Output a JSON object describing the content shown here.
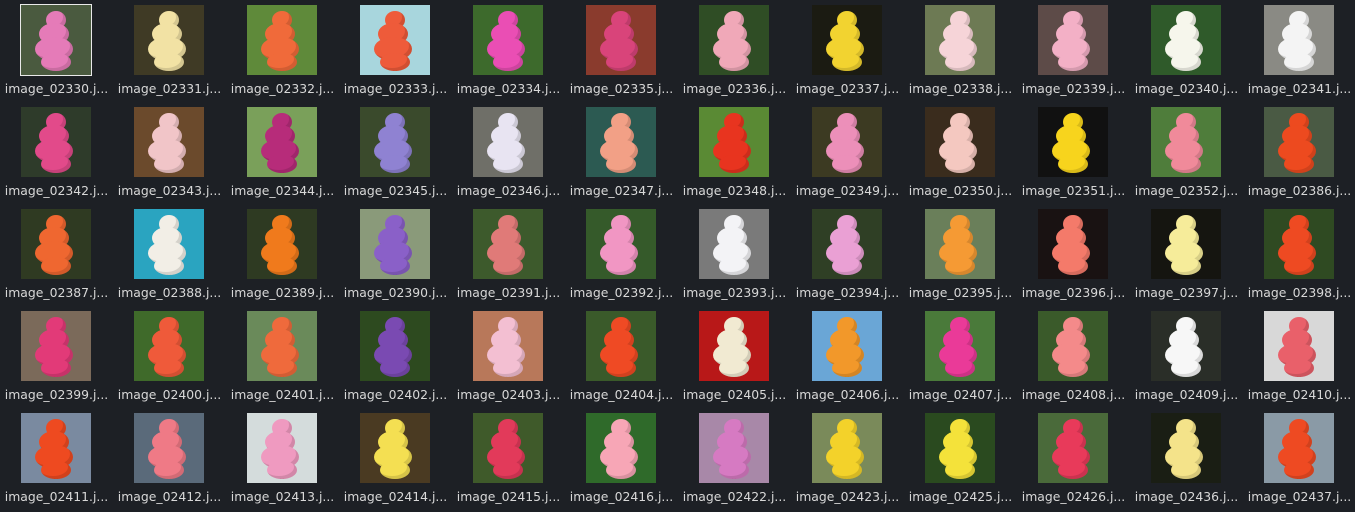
{
  "files": [
    {
      "name": "image_02330.j...",
      "color": "#e57bb8",
      "bg": "#4a5a3f",
      "selected": true
    },
    {
      "name": "image_02331.j...",
      "color": "#f2e2a4",
      "bg": "#3f3a25"
    },
    {
      "name": "image_02332.j...",
      "color": "#f06a3a",
      "bg": "#5f8a3a"
    },
    {
      "name": "image_02333.j...",
      "color": "#ee5b3a",
      "bg": "#a8d6dd"
    },
    {
      "name": "image_02334.j...",
      "color": "#ea4eb4",
      "bg": "#3d6a2c"
    },
    {
      "name": "image_02335.j...",
      "color": "#d9447a",
      "bg": "#8a3b2d"
    },
    {
      "name": "image_02336.j...",
      "color": "#f0a8b8",
      "bg": "#2f4d25"
    },
    {
      "name": "image_02337.j...",
      "color": "#f2d330",
      "bg": "#1b1b12"
    },
    {
      "name": "image_02338.j...",
      "color": "#f6d4d8",
      "bg": "#6d7a54"
    },
    {
      "name": "image_02339.j...",
      "color": "#f3b0c6",
      "bg": "#5d4b48"
    },
    {
      "name": "image_02340.j...",
      "color": "#f6f6ec",
      "bg": "#2f5a2a"
    },
    {
      "name": "image_02341.j...",
      "color": "#f4f4f4",
      "bg": "#8a8a84"
    },
    {
      "name": "image_02342.j...",
      "color": "#e24a8a",
      "bg": "#2e3b2a"
    },
    {
      "name": "image_02343.j...",
      "color": "#f1c5c8",
      "bg": "#6b4a2c"
    },
    {
      "name": "image_02344.j...",
      "color": "#b72c7a",
      "bg": "#7aa05a"
    },
    {
      "name": "image_02345.j...",
      "color": "#8f82d2",
      "bg": "#3a4a2c"
    },
    {
      "name": "image_02346.j...",
      "color": "#e8e4f2",
      "bg": "#6f6f68"
    },
    {
      "name": "image_02347.j...",
      "color": "#f2a086",
      "bg": "#2c5a52"
    },
    {
      "name": "image_02348.j...",
      "color": "#e8341f",
      "bg": "#5a8a34"
    },
    {
      "name": "image_02349.j...",
      "color": "#ec8fb9",
      "bg": "#3c3a22"
    },
    {
      "name": "image_02350.j...",
      "color": "#f4c8c0",
      "bg": "#3a2c1d"
    },
    {
      "name": "image_02351.j...",
      "color": "#f7d41d",
      "bg": "#111111"
    },
    {
      "name": "image_02352.j...",
      "color": "#f08a9a",
      "bg": "#4f7d3b"
    },
    {
      "name": "image_02386.j...",
      "color": "#ed4a1f",
      "bg": "#4a5a44"
    },
    {
      "name": "image_02387.j...",
      "color": "#ef6730",
      "bg": "#2f3a22"
    },
    {
      "name": "image_02388.j...",
      "color": "#f2eee6",
      "bg": "#2aa4c0"
    },
    {
      "name": "image_02389.j...",
      "color": "#f07a1c",
      "bg": "#2e3a22"
    },
    {
      "name": "image_02390.j...",
      "color": "#8a60c8",
      "bg": "#8a9a7a"
    },
    {
      "name": "image_02391.j...",
      "color": "#e07a78",
      "bg": "#3d5a2c"
    },
    {
      "name": "image_02392.j...",
      "color": "#f196c3",
      "bg": "#355a2a"
    },
    {
      "name": "image_02393.j...",
      "color": "#f3f3f6",
      "bg": "#7a7a7a"
    },
    {
      "name": "image_02394.j...",
      "color": "#eaa0d4",
      "bg": "#2f3f25"
    },
    {
      "name": "image_02395.j...",
      "color": "#f59a34",
      "bg": "#6a7f5a"
    },
    {
      "name": "image_02396.j...",
      "color": "#f47a6a",
      "bg": "#191212"
    },
    {
      "name": "image_02397.j...",
      "color": "#f6ec9a",
      "bg": "#151510"
    },
    {
      "name": "image_02398.j...",
      "color": "#ee4a22",
      "bg": "#2f4a22"
    },
    {
      "name": "image_02399.j...",
      "color": "#e23a78",
      "bg": "#7b6a5a"
    },
    {
      "name": "image_02400.j...",
      "color": "#ef5a3a",
      "bg": "#3f6a2a"
    },
    {
      "name": "image_02401.j...",
      "color": "#ef6a3c",
      "bg": "#6a8a5a"
    },
    {
      "name": "image_02402.j...",
      "color": "#7a4ab2",
      "bg": "#2d4a1f"
    },
    {
      "name": "image_02403.j...",
      "color": "#f3bfd2",
      "bg": "#b8785a"
    },
    {
      "name": "image_02404.j...",
      "color": "#ef4a24",
      "bg": "#3a5a2a"
    },
    {
      "name": "image_02405.j...",
      "color": "#f1ead2",
      "bg": "#b81818"
    },
    {
      "name": "image_02406.j...",
      "color": "#f2982a",
      "bg": "#6aa6d6"
    },
    {
      "name": "image_02407.j...",
      "color": "#ea3a98",
      "bg": "#4a7a3a"
    },
    {
      "name": "image_02408.j...",
      "color": "#f48a8a",
      "bg": "#3a5a2a"
    },
    {
      "name": "image_02409.j...",
      "color": "#f7f7f7",
      "bg": "#2a2e28"
    },
    {
      "name": "image_02410.j...",
      "color": "#e9606a",
      "bg": "#d8d8d8"
    },
    {
      "name": "image_02411.j...",
      "color": "#ee4a20",
      "bg": "#7a8aa0"
    },
    {
      "name": "image_02412.j...",
      "color": "#ef7a86",
      "bg": "#5a6a7a"
    },
    {
      "name": "image_02413.j...",
      "color": "#ef9ac0",
      "bg": "#d4dcdc"
    },
    {
      "name": "image_02414.j...",
      "color": "#f4df52",
      "bg": "#4a3a22"
    },
    {
      "name": "image_02415.j...",
      "color": "#e23a5a",
      "bg": "#3f5a2a"
    },
    {
      "name": "image_02416.j...",
      "color": "#f7a6b6",
      "bg": "#2f6a2a"
    },
    {
      "name": "image_02422.j...",
      "color": "#d67ac2",
      "bg": "#a888a8"
    },
    {
      "name": "image_02423.j...",
      "color": "#f3d22a",
      "bg": "#7a8a5a"
    },
    {
      "name": "image_02425.j...",
      "color": "#f4e23a",
      "bg": "#2a4a1f"
    },
    {
      "name": "image_02426.j...",
      "color": "#e83a5a",
      "bg": "#4a6a3a"
    },
    {
      "name": "image_02436.j...",
      "color": "#f4e38a",
      "bg": "#1a1e14"
    },
    {
      "name": "image_02437.j...",
      "color": "#ee4a22",
      "bg": "#8a9aa6"
    }
  ]
}
